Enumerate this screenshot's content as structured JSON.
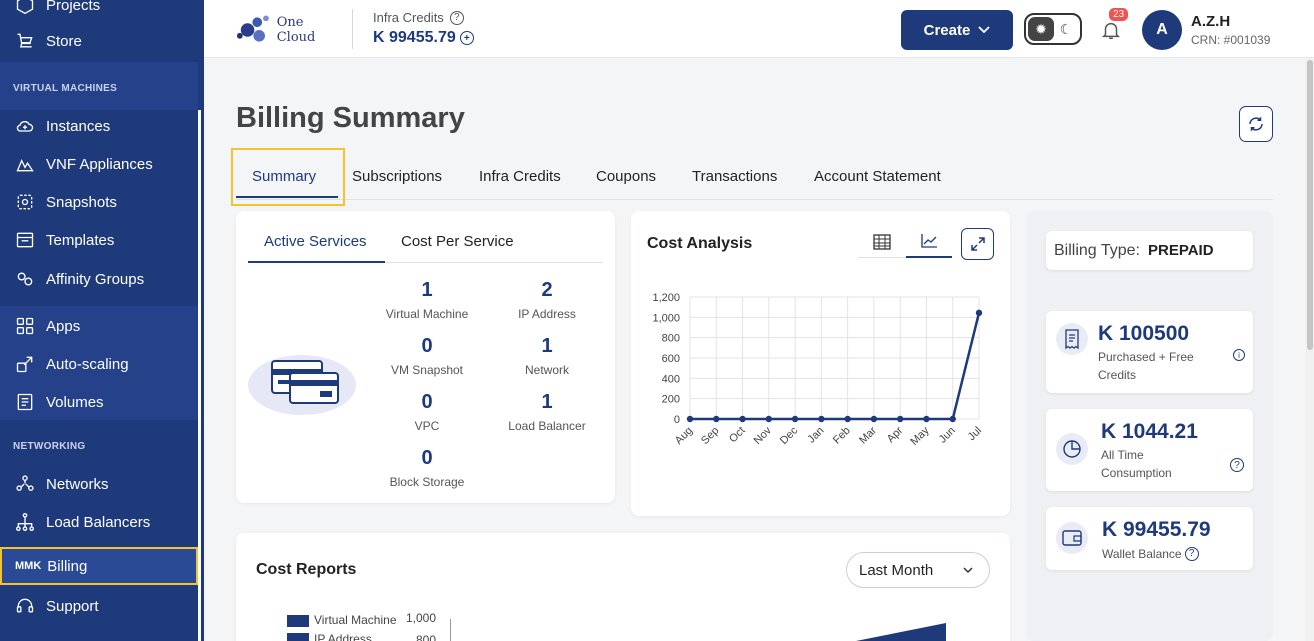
{
  "sidebar": {
    "items_top": [
      {
        "label": "Projects",
        "icon": "hexagon-icon"
      },
      {
        "label": "Store",
        "icon": "cart-icon"
      }
    ],
    "section_vm": "VIRTUAL MACHINES",
    "items_vm": [
      {
        "label": "Instances",
        "icon": "cloud-icon"
      },
      {
        "label": "VNF Appliances",
        "icon": "vnf-icon"
      },
      {
        "label": "Snapshots",
        "icon": "snapshot-icon"
      },
      {
        "label": "Templates",
        "icon": "template-icon"
      },
      {
        "label": "Affinity Groups",
        "icon": "affinity-icon"
      }
    ],
    "items_apps": [
      {
        "label": "Apps",
        "icon": "apps-icon"
      },
      {
        "label": "Auto-scaling",
        "icon": "autoscale-icon"
      },
      {
        "label": "Volumes",
        "icon": "volume-icon"
      }
    ],
    "section_net": "NETWORKING",
    "items_net": [
      {
        "label": "Networks",
        "icon": "network-icon"
      },
      {
        "label": "Load Balancers",
        "icon": "loadbalancer-icon"
      }
    ],
    "billing": {
      "prefix": "MMK",
      "label": "Billing"
    },
    "support": {
      "label": "Support",
      "icon": "headset-icon"
    }
  },
  "header": {
    "logo_text": "One Cloud",
    "credits_label": "Infra Credits",
    "credits_value": "K 99455.79",
    "create_label": "Create",
    "notif_count": "23",
    "avatar_letter": "A",
    "user_name": "A.Z.H",
    "user_crn": "CRN: #001039"
  },
  "page": {
    "title": "Billing Summary",
    "tabs": [
      "Summary",
      "Subscriptions",
      "Infra Credits",
      "Coupons",
      "Transactions",
      "Account Statement"
    ]
  },
  "services": {
    "tabs": [
      "Active Services",
      "Cost Per Service"
    ],
    "items": [
      {
        "count": "1",
        "label": "Virtual Machine"
      },
      {
        "count": "2",
        "label": "IP Address"
      },
      {
        "count": "0",
        "label": "VM Snapshot"
      },
      {
        "count": "1",
        "label": "Network"
      },
      {
        "count": "0",
        "label": "VPC"
      },
      {
        "count": "1",
        "label": "Load Balancer"
      },
      {
        "count": "0",
        "label": "Block Storage"
      }
    ]
  },
  "cost_analysis": {
    "title": "Cost Analysis"
  },
  "chart_data": [
    {
      "type": "line",
      "categories": [
        "Aug",
        "Sep",
        "Oct",
        "Nov",
        "Dec",
        "Jan",
        "Feb",
        "Mar",
        "Apr",
        "May",
        "Jun",
        "Jul"
      ],
      "values": [
        0,
        0,
        0,
        0,
        0,
        0,
        0,
        0,
        0,
        0,
        0,
        1044.21
      ],
      "ylim": [
        0,
        1200
      ],
      "yticks": [
        "0",
        "200",
        "400",
        "600",
        "800",
        "1,000",
        "1,200"
      ],
      "grid": true,
      "color": "#1e3a7a"
    }
  ],
  "right": {
    "billing_type_label": "Billing Type:",
    "billing_type_value": "PREPAID",
    "purchased_value": "K 100500",
    "purchased_label": "Purchased + Free Credits",
    "consumption_value": "K 1044.21",
    "consumption_label": "All Time Consumption",
    "wallet_value": "K 99455.79",
    "wallet_label": "Wallet Balance"
  },
  "cost_reports": {
    "title": "Cost Reports",
    "period": "Last Month",
    "legend": [
      "Virtual Machine",
      "IP Address"
    ],
    "y_ticks": [
      "1,000",
      "800"
    ]
  },
  "colors": {
    "primary": "#1e3a7a",
    "highlight": "#f4c430",
    "badge": "#ef5350"
  }
}
